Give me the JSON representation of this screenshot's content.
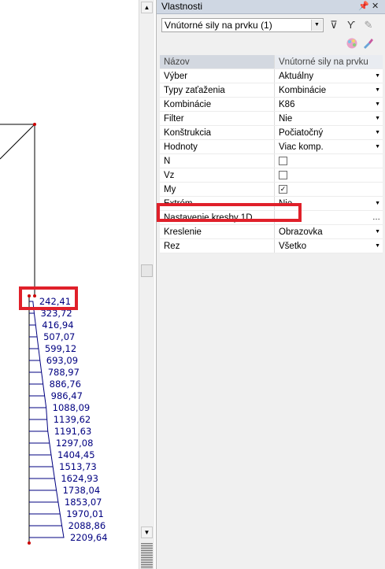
{
  "panel": {
    "title": "Vlastnosti",
    "pin_icon": "pin-icon",
    "close_icon": "close-icon",
    "selected_object": "Vnútorné sily na prvku (1)",
    "toolbar_icons": [
      "filter-select-icon",
      "filter-lightning-icon",
      "pencil-icon",
      "color-palette-icon",
      "brush-icon"
    ]
  },
  "properties": {
    "header": {
      "name": "Názov",
      "value": "Vnútorné sily na prvku"
    },
    "rows": [
      {
        "name": "Výber",
        "value": "Aktuálny",
        "kind": "dropdown"
      },
      {
        "name": "Typy zaťaženia",
        "value": "Kombinácie",
        "kind": "dropdown"
      },
      {
        "name": "Kombinácie",
        "value": "K86",
        "kind": "dropdown"
      },
      {
        "name": "Filter",
        "value": "Nie",
        "kind": "dropdown"
      },
      {
        "name": "Konštrukcia",
        "value": "Počiatočný",
        "kind": "dropdown"
      },
      {
        "name": "Hodnoty",
        "value": "Viac komp.",
        "kind": "dropdown"
      },
      {
        "name": "N",
        "value": "",
        "kind": "checkbox",
        "checked": false
      },
      {
        "name": "Vz",
        "value": "",
        "kind": "checkbox",
        "checked": false
      },
      {
        "name": "My",
        "value": "",
        "kind": "checkbox",
        "checked": true
      },
      {
        "name": "Extrém",
        "value": "Nie",
        "kind": "dropdown"
      },
      {
        "name": "Nastavenie kresby 1D",
        "value": "",
        "kind": "ellipsis"
      },
      {
        "name": "Kreslenie",
        "value": "Obrazovka",
        "kind": "dropdown"
      },
      {
        "name": "Rez",
        "value": "Všetko",
        "kind": "dropdown"
      }
    ]
  },
  "diagram": {
    "values": [
      "242,41",
      "323,72",
      "416,94",
      "507,07",
      "599,12",
      "693,09",
      "788,97",
      "886,76",
      "986,47",
      "1088,09",
      "1139,62",
      "1191,63",
      "1297,08",
      "1404,45",
      "1513,73",
      "1624,93",
      "1738,04",
      "1853,07",
      "1970,01",
      "2088,86",
      "2209,64"
    ],
    "line_color": "#000080",
    "node_color": "#cc0000"
  },
  "highlight_color": "#e0202a"
}
